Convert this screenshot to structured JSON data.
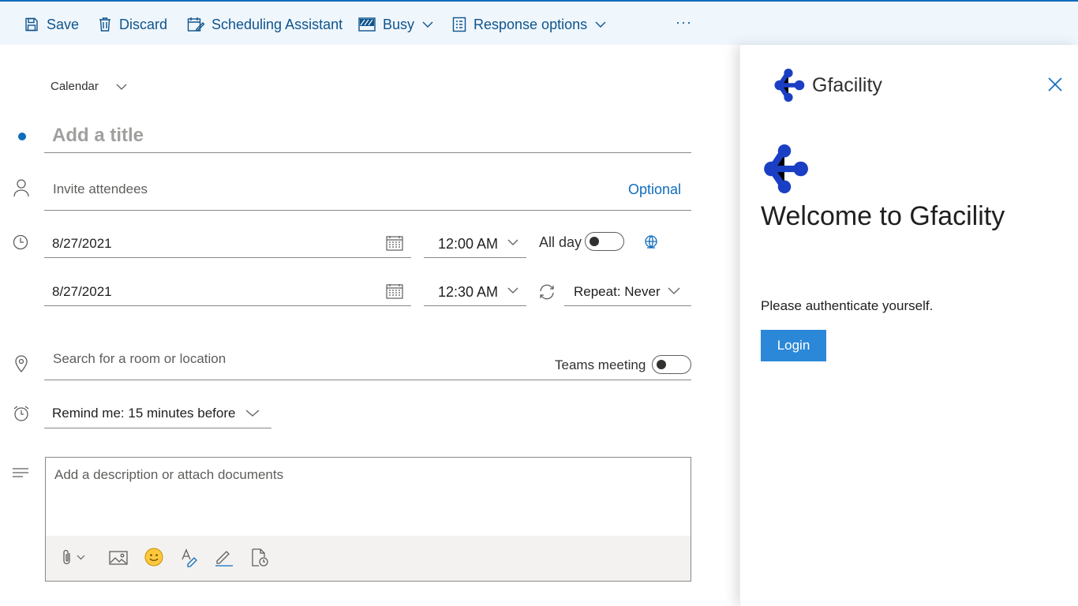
{
  "toolbar": {
    "save": "Save",
    "discard": "Discard",
    "scheduling": "Scheduling Assistant",
    "busy": "Busy",
    "response_options": "Response options",
    "more": "···"
  },
  "form": {
    "calendar_label": "Calendar",
    "title_placeholder": "Add a title",
    "attendees_placeholder": "Invite attendees",
    "optional": "Optional",
    "start_date": "8/27/2021",
    "start_time": "12:00 AM",
    "end_date": "8/27/2021",
    "end_time": "12:30 AM",
    "all_day": "All day",
    "repeat": "Repeat:  Never",
    "location_placeholder": "Search for a room or location",
    "teams_meeting": "Teams meeting",
    "remind": "Remind me:  15 minutes before",
    "description_placeholder": "Add a description or attach documents"
  },
  "pane": {
    "app_name": "Gfacility",
    "welcome": "Welcome to Gfacility",
    "auth_text": "Please authenticate yourself.",
    "login": "Login"
  },
  "colors": {
    "accent": "#0f6cbd",
    "logo": "#1a3fc4",
    "login_button": "#2b88d8",
    "toolbar_bg": "#eff6fc"
  }
}
